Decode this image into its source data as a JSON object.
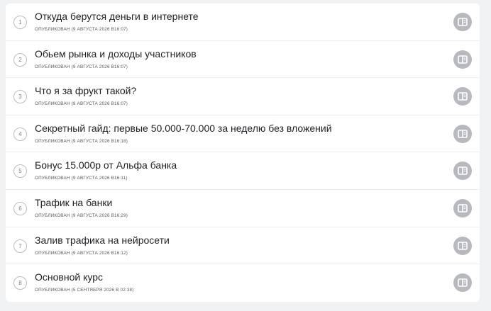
{
  "lessons": [
    {
      "number": "1",
      "title": "Откуда берутся деньги в интернете",
      "published": "ОПУБЛИКОВАН (9 АВГУСТА 2026 В16:07)",
      "icon": "book-open-icon"
    },
    {
      "number": "2",
      "title": "Обьем рынка и доходы участников",
      "published": "ОПУБЛИКОВАН (9 АВГУСТА 2026 В16:07)",
      "icon": "book-open-icon"
    },
    {
      "number": "3",
      "title": "Что я за фрукт такой?",
      "published": "ОПУБЛИКОВАН (9 АВГУСТА 2026 В16:07)",
      "icon": "book-open-icon"
    },
    {
      "number": "4",
      "title": "Секретный гайд: первые 50.000-70.000 за неделю без вложений",
      "published": "ОПУБЛИКОВАН (9 АВГУСТА 2026 В16:18)",
      "icon": "book-open-icon"
    },
    {
      "number": "5",
      "title": "Бонус 15.000р от Альфа банка",
      "published": "ОПУБЛИКОВАН (9 АВГУСТА 2026 В16:11)",
      "icon": "book-open-icon"
    },
    {
      "number": "6",
      "title": "Трафик на банки",
      "published": "ОПУБЛИКОВАН (9 АВГУСТА 2026 В16:29)",
      "icon": "book-open-icon"
    },
    {
      "number": "7",
      "title": "Залив трафика на нейросети",
      "published": "ОПУБЛИКОВАН (9 АВГУСТА 2026 В16:12)",
      "icon": "book-open-icon"
    },
    {
      "number": "8",
      "title": "Основной курс",
      "published": "ОПУБЛИКОВАН (5 СЕНТЯБРЯ 2026 В 02:38)",
      "icon": "book-open-icon"
    }
  ],
  "colors": {
    "background": "#f1f2f4",
    "card": "#ffffff",
    "title": "#1d1f24",
    "meta": "#52565e",
    "action_button": "#b7b9be"
  }
}
